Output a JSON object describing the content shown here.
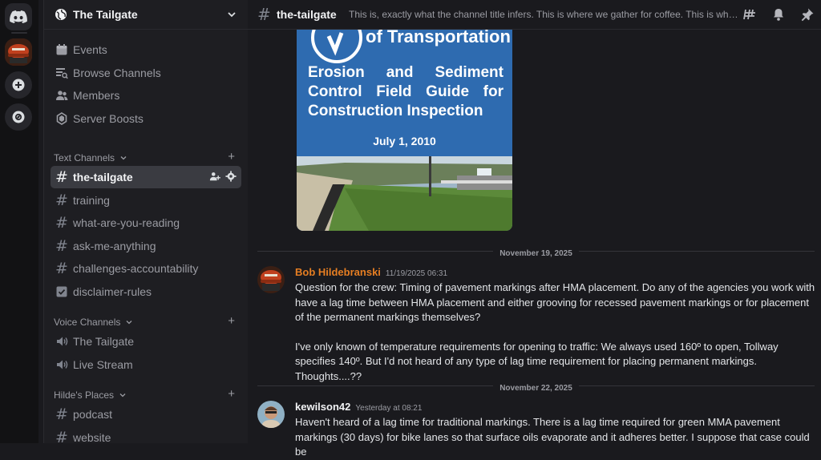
{
  "server": {
    "name": "The Tailgate"
  },
  "nav": [
    {
      "label": "Events",
      "icon": "calendar-icon"
    },
    {
      "label": "Browse Channels",
      "icon": "browse-channels-icon"
    },
    {
      "label": "Members",
      "icon": "members-icon"
    },
    {
      "label": "Server Boosts",
      "icon": "boost-icon"
    }
  ],
  "text_channels": {
    "label": "Text Channels",
    "items": [
      "the-tailgate",
      "training",
      "what-are-you-reading",
      "ask-me-anything",
      "challenges-accountability"
    ],
    "rules": "disclaimer-rules"
  },
  "voice_channels": {
    "label": "Voice Channels",
    "items": [
      "The Tailgate",
      "Live Stream"
    ]
  },
  "hildes_places": {
    "label": "Hilde's Places",
    "items": [
      "podcast",
      "website"
    ]
  },
  "channel": {
    "name": "the-tailgate",
    "topic": "This is, exactly what the channel title infers. This is where we gather for coffee. This is where w..."
  },
  "attachment": {
    "agency": "of Transportation",
    "title": "Erosion and Sediment Control Field Guide for Construction Inspection",
    "date": "July 1, 2010"
  },
  "dividers": [
    "November 19, 2025",
    "November 22, 2025"
  ],
  "messages": [
    {
      "author": "Bob Hildebranski",
      "author_color": "#e67e22",
      "timestamp": "11/19/2025 06:31",
      "paragraphs": [
        "Question for the crew: Timing of pavement markings after HMA placement. Do any of the agencies you work with have a lag time between HMA placement and either grooving for recessed pavement markings or for placement of the permanent markings themselves?",
        "I've only known of temperature requirements for opening to traffic: We always used 160º to open, Tollway specifies 140º. But I'd not heard of any type of lag time requirement for placing permanent markings. Thoughts....??"
      ]
    },
    {
      "author": "kewilson42",
      "author_color": "#f2f3f5",
      "timestamp": "Yesterday at 08:21",
      "paragraphs": [
        "Haven't heard of a lag time for traditional markings.  There is a lag time required for green MMA pavement markings (30 days) for bike lanes so that surface oils evaporate and it adheres better.  I suppose that case could be"
      ]
    }
  ],
  "colors": {
    "background": "#1a1a1e",
    "sidebar": "#1e1e22",
    "active_channel": "#3a3b41",
    "discord_blurple": "#5865f2",
    "attachment_blue": "#2e6bb0"
  }
}
